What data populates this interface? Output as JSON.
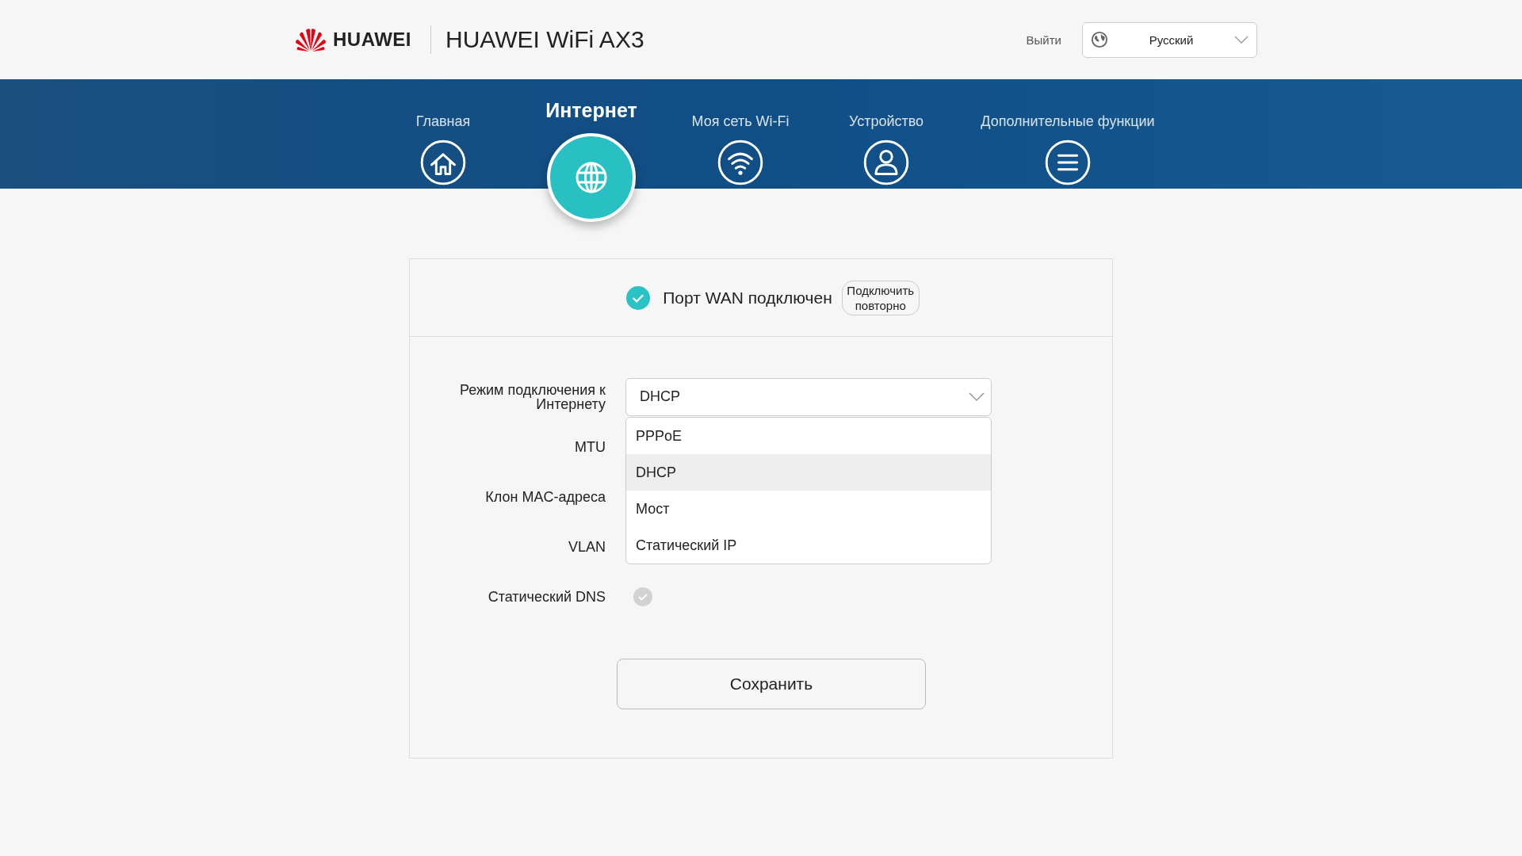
{
  "header": {
    "brand": "HUAWEI",
    "product": "HUAWEI WiFi AX3",
    "logout": "Выйти",
    "language": "Русский"
  },
  "nav": [
    {
      "label": "Главная",
      "selected": false
    },
    {
      "label": "Интернет",
      "selected": true
    },
    {
      "label": "Моя сеть Wi-Fi",
      "selected": false
    },
    {
      "label": "Устройство",
      "selected": false
    },
    {
      "label": "Дополнительные функции",
      "selected": false
    }
  ],
  "status": {
    "text": "Порт WAN подключен",
    "connected": true,
    "button": "Подключить повторно"
  },
  "form": {
    "mode_label": "Режим подключения к Интернету",
    "mode_value": "DHCP",
    "expanded": true,
    "options": [
      {
        "label": "PPPoE",
        "selected": false
      },
      {
        "label": "DHCP",
        "selected": true
      },
      {
        "label": "Мост",
        "selected": false
      },
      {
        "label": "Статический IP",
        "selected": false
      }
    ],
    "mtu_label": "MTU",
    "mac_label": "Клон MAC-адреса",
    "vlan_label": "VLAN",
    "dns_label": "Статический DNS",
    "dns_checked": false
  },
  "save": "Сохранить"
}
